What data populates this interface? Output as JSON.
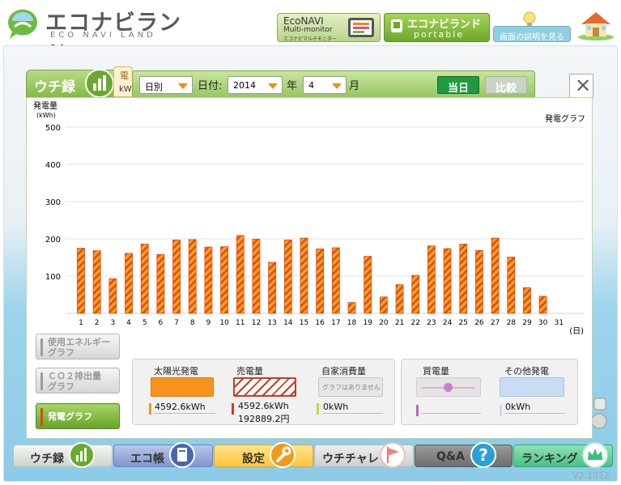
{
  "header": {
    "logo_main": "エコナビランド",
    "logo_sub": "ECO NAVI LAND",
    "econavi": {
      "line1": "EcoNAVI",
      "line2": "Multi-monitor",
      "line3": "エコナビマルチモニター"
    },
    "portable": {
      "line1": "エコナビランド",
      "line2": "portable"
    },
    "help_label": "画面の説明を見る"
  },
  "window": {
    "tab_label": "ウチ録",
    "peek_tab_kanji": "電",
    "peek_tab_unit": "kW",
    "toolbar": {
      "period_value": "日別",
      "date_label": "日付:",
      "year_value": "2014",
      "year_label": "年",
      "month_value": "4",
      "month_label": "月",
      "today_label": "当日",
      "compare_label": "比較"
    },
    "close_symbol": "✕"
  },
  "side_buttons": {
    "usage_line1": "使用エネルギー",
    "usage_line2": "グラフ",
    "co2_line1": "ＣＯ２排出量",
    "co2_line2": "グラフ",
    "gen_label": "発電グラフ"
  },
  "legend": {
    "solar_title": "太陽光発電",
    "solar_value": "4592.6kWh",
    "sell_title": "売電量",
    "sell_value": "4592.6kWh",
    "sell_yen": "192889.2円",
    "self_title": "自家消費量",
    "self_placeholder": "グラフはありません",
    "self_value": "0kWh",
    "buy_title": "買電量",
    "other_title": "その他発電",
    "other_value": "0kWh"
  },
  "nav": {
    "uchi": "ウチ録",
    "eco": "エコ帳",
    "setting": "設定",
    "chare": "ウチチャレ",
    "qa": "Q&A",
    "rank": "ランキング"
  },
  "version": "V2.1012",
  "colors": {
    "bar_fill": "#f7a21b",
    "bar_stripe": "#e2461a",
    "solar": "#f7941d",
    "sell_border": "#cc3b1f",
    "self": "#c8d63a",
    "buy": "#b468b8",
    "other": "#c9dcf3",
    "toolbar_green": "#98c664",
    "today_green": "#1f9a3f"
  },
  "chart_data": {
    "type": "bar",
    "title": "発電グラフ",
    "ylabel_line1": "発電量",
    "ylabel_line2": "(kWh)",
    "xunit": "(日)",
    "ylim": [
      0,
      500
    ],
    "yticks": [
      100,
      200,
      300,
      400,
      500
    ],
    "grid": true,
    "categories": [
      "1",
      "2",
      "3",
      "4",
      "5",
      "6",
      "7",
      "8",
      "9",
      "10",
      "11",
      "12",
      "13",
      "14",
      "15",
      "16",
      "17",
      "18",
      "19",
      "20",
      "21",
      "22",
      "23",
      "24",
      "25",
      "26",
      "27",
      "28",
      "29",
      "30",
      "31"
    ],
    "series": [
      {
        "name": "発電量",
        "values": [
          175,
          168,
          93,
          161,
          186,
          158,
          197,
          198,
          178,
          179,
          209,
          199,
          137,
          197,
          202,
          173,
          176,
          29,
          153,
          44,
          77,
          102,
          181,
          174,
          186,
          169,
          202,
          151,
          69,
          46,
          0
        ]
      }
    ]
  }
}
